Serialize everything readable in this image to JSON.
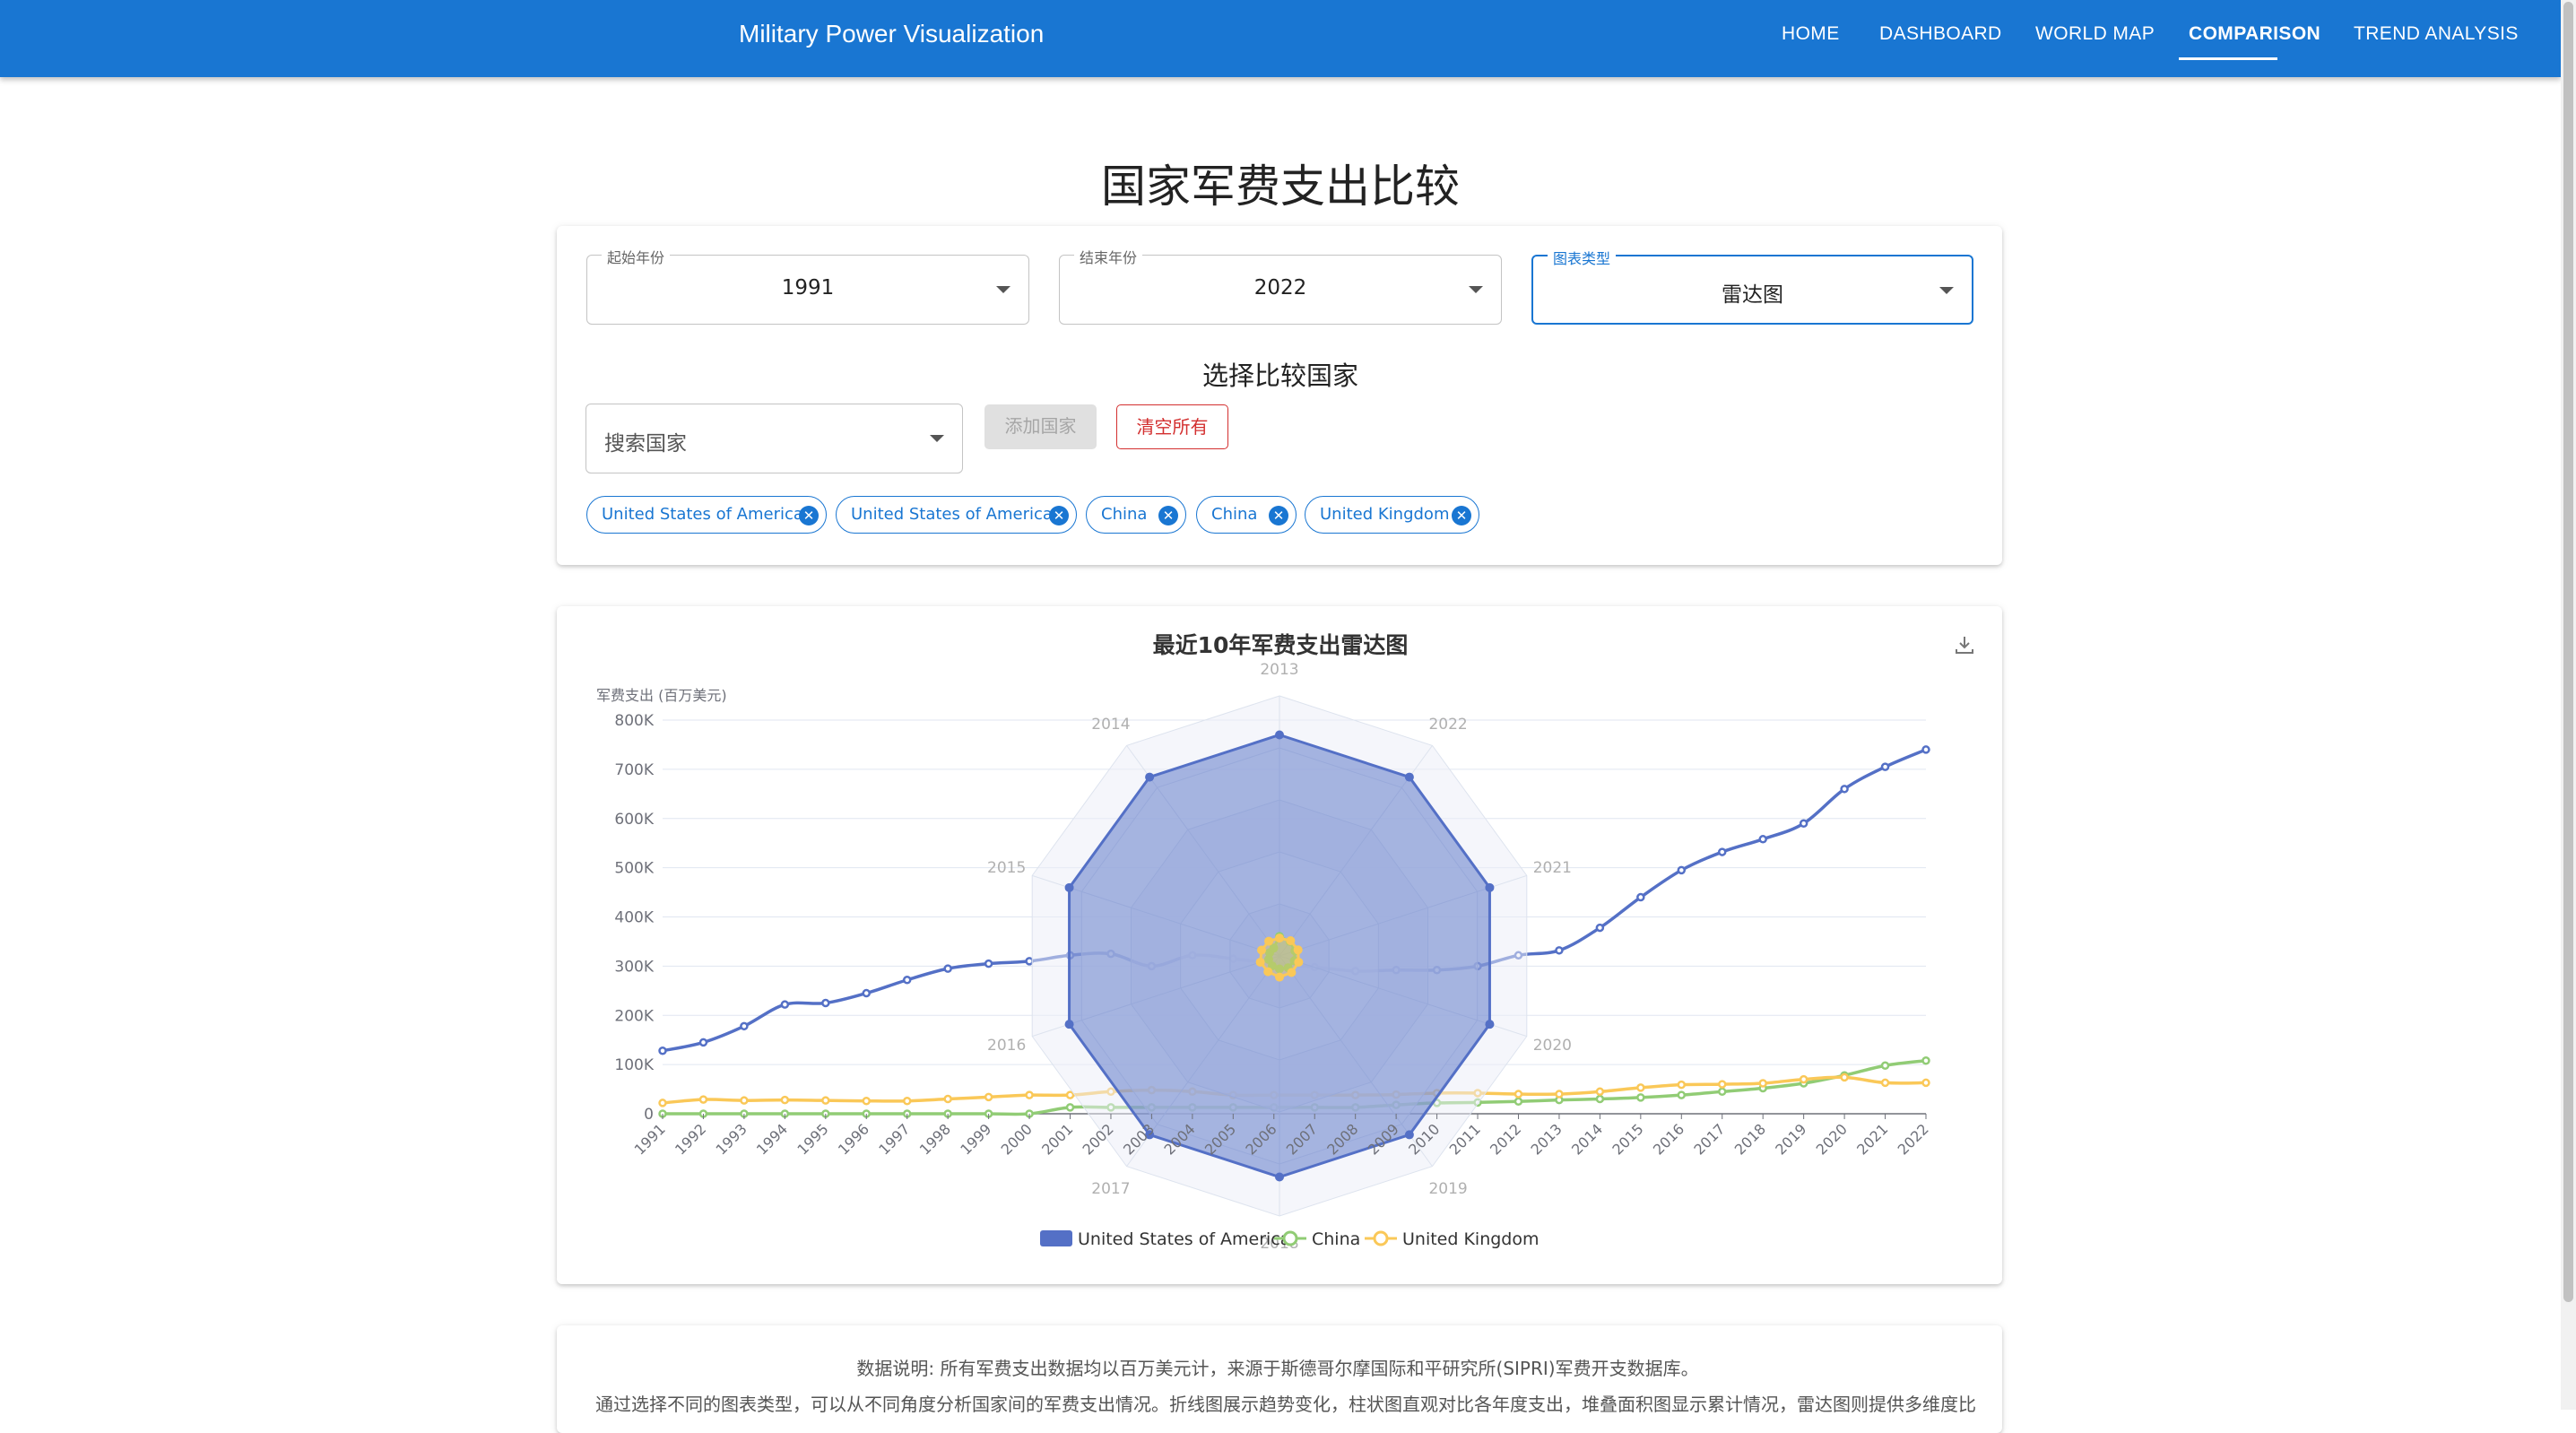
{
  "app": {
    "brand": "Military Power Visualization",
    "nav": [
      {
        "label": "HOME"
      },
      {
        "label": "DASHBOARD"
      },
      {
        "label": "WORLD MAP"
      },
      {
        "label": "COMPARISON",
        "active": true
      },
      {
        "label": "TREND ANALYSIS"
      }
    ]
  },
  "page": {
    "title": "国家军费支出比较"
  },
  "controls": {
    "start_year": {
      "label": "起始年份",
      "value": "1991"
    },
    "end_year": {
      "label": "结束年份",
      "value": "2022"
    },
    "chart_type": {
      "label": "图表类型",
      "value": "雷达图"
    },
    "section_title": "选择比较国家",
    "search_placeholder": "搜索国家",
    "add_button": "添加国家",
    "clear_button": "清空所有",
    "chips": [
      "United States of America",
      "United States of America",
      "China",
      "China",
      "United Kingdom"
    ]
  },
  "colors": {
    "usa": "#5470c6",
    "china": "#91cc75",
    "uk": "#fac858",
    "accent": "#1976d2",
    "danger": "#d32f2f"
  },
  "chart_data": [
    {
      "type": "line",
      "title": "最近10年军费支出雷达图",
      "ylabel": "军费支出 (百万美元)",
      "ylim": [
        0,
        800000
      ],
      "y_ticks": [
        "0",
        "100K",
        "200K",
        "300K",
        "400K",
        "500K",
        "600K",
        "700K",
        "800K"
      ],
      "x": [
        "1991",
        "1992",
        "1993",
        "1994",
        "1995",
        "1996",
        "1997",
        "1998",
        "1999",
        "2000",
        "2001",
        "2002",
        "2003",
        "2004",
        "2005",
        "2006",
        "2007",
        "2008",
        "2009",
        "2010",
        "2011",
        "2012",
        "2013",
        "2014",
        "2015",
        "2016",
        "2017",
        "2018",
        "2019",
        "2020",
        "2021",
        "2022"
      ],
      "series": [
        {
          "name": "United States of America",
          "color": "#5470c6",
          "values": [
            128000,
            145000,
            178000,
            222000,
            225000,
            245000,
            272000,
            295000,
            305000,
            310000,
            322000,
            325000,
            300000,
            322000,
            315000,
            305000,
            298000,
            290000,
            292000,
            292000,
            300000,
            322000,
            332000,
            378000,
            440000,
            495000,
            532000,
            558000,
            590000,
            660000,
            705000,
            740000
          ]
        },
        {
          "name": "China",
          "color": "#91cc75",
          "values": [
            0,
            0,
            0,
            0,
            0,
            0,
            0,
            0,
            0,
            0,
            13000,
            13000,
            13000,
            13000,
            13000,
            13000,
            13000,
            13000,
            18000,
            22000,
            23000,
            25000,
            28000,
            30000,
            33000,
            38000,
            45000,
            52000,
            62000,
            78000,
            98000,
            108000
          ]
        },
        {
          "name": "United Kingdom",
          "color": "#fac858",
          "values": [
            22000,
            29000,
            27000,
            28000,
            27000,
            26000,
            26000,
            30000,
            34000,
            38000,
            38000,
            45000,
            48000,
            45000,
            38000,
            38000,
            38000,
            38000,
            39000,
            42000,
            42000,
            40000,
            40000,
            45000,
            53000,
            59000,
            60000,
            62000,
            70000,
            74000,
            63000,
            63000
          ]
        }
      ],
      "grid": true,
      "legend": "bottom-center"
    },
    {
      "type": "radar",
      "indicators": [
        "2013",
        "2022",
        "2021",
        "2020",
        "2019",
        "2018",
        "2017",
        "2016",
        "2015",
        "2014"
      ],
      "max": 800000,
      "series": [
        {
          "name": "United States of America",
          "color": "#5470c6",
          "area": true,
          "values": [
            680000,
            680000,
            680000,
            680000,
            680000,
            680000,
            680000,
            680000,
            680000,
            680000
          ]
        },
        {
          "name": "China",
          "color": "#91cc75",
          "values": [
            60000,
            55000,
            50000,
            48000,
            45000,
            40000,
            38000,
            35000,
            32000,
            30000
          ]
        },
        {
          "name": "United Kingdom",
          "color": "#fac858",
          "values": [
            55000,
            58000,
            60000,
            62000,
            63000,
            65000,
            60000,
            62000,
            58000,
            56000
          ]
        }
      ]
    }
  ],
  "notes": {
    "line1": "数据说明: 所有军费支出数据均以百万美元计，来源于斯德哥尔摩国际和平研究所(SIPRI)军费开支数据库。",
    "line2": "通过选择不同的图表类型，可以从不同角度分析国家间的军费支出情况。折线图展示趋势变化，柱状图直观对比各年度支出，堆叠面积图显示累计情况，雷达图则提供多维度比"
  }
}
